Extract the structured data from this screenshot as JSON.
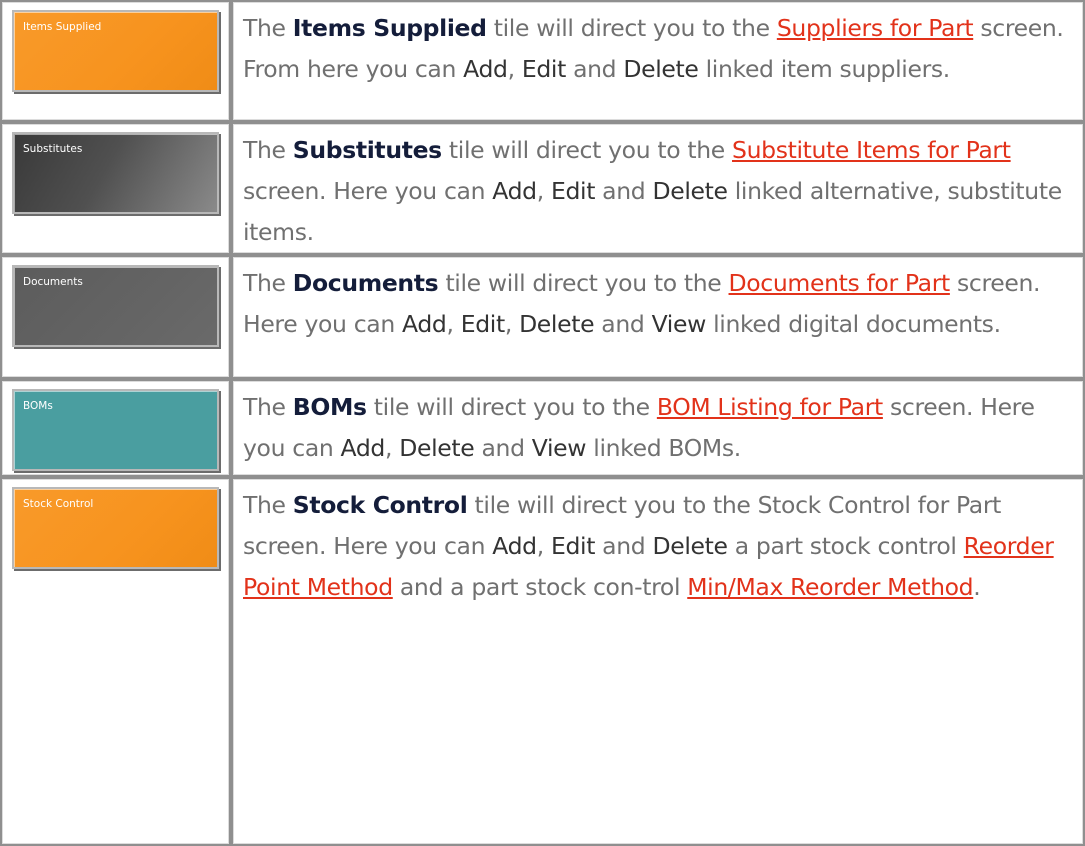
{
  "rows": [
    {
      "tile": {
        "label": "Items Supplied",
        "color": "#f7931e"
      },
      "text": {
        "s1": "The ",
        "b1": "Items Supplied",
        "s2": " tile will direct you to the ",
        "link1": "Suppliers for Part",
        "s3": " screen. From here you can ",
        "k1": "Add",
        "s4": ", ",
        "k2": "Edit",
        "s5": " and ",
        "k3": "Delete",
        "s6": " linked item suppliers."
      }
    },
    {
      "tile": {
        "label": "Substitutes",
        "color": "#3f3f3f"
      },
      "text": {
        "s1": "The ",
        "b1": "Substitutes",
        "s2": " tile will direct you to the ",
        "link1": "Substitute Items for Part",
        "s3": " screen. Here you can ",
        "k1": "Add",
        "s4": ", ",
        "k2": "Edit",
        "s5": " and ",
        "k3": "Delete",
        "s6": " linked alternative, substitute items."
      }
    },
    {
      "tile": {
        "label": "Documents",
        "color": "#616161"
      },
      "text": {
        "s1": "The ",
        "b1": "Documents",
        "s2": " tile will direct you to the ",
        "link1": "Documents for Part",
        "s3": " screen. Here you can ",
        "k1": "Add",
        "s4": ", ",
        "k2": "Edit",
        "s5": ", ",
        "k3": "Delete",
        "s6": " and ",
        "k4": "View",
        "s7": " linked digital documents."
      }
    },
    {
      "tile": {
        "label": "BOMs",
        "color": "#4a9ea0"
      },
      "text": {
        "s1": "The ",
        "b1": "BOMs",
        "s2": " tile will direct you to the ",
        "link1": "BOM Listing for Part",
        "s3": " screen. Here you can ",
        "k1": "Add",
        "s4": ", ",
        "k2": "Delete",
        "s5": " and ",
        "k3": "View",
        "s6": " linked BOMs."
      }
    },
    {
      "tile": {
        "label": "Stock Control",
        "color": "#f7931e"
      },
      "text": {
        "s1": "The ",
        "b1": "Stock Control",
        "s2": " tile will direct you to the Stock Control for Part screen. Here you can ",
        "k1": "Add",
        "s3": ", ",
        "k2": "Edit",
        "s4": " and ",
        "k3": "Delete",
        "s5": " a part stock control ",
        "link1": "Reorder Point Method",
        "s6": " and a part stock con-trol ",
        "link2": "Min/Max Reorder Method",
        "s7": "."
      }
    }
  ]
}
